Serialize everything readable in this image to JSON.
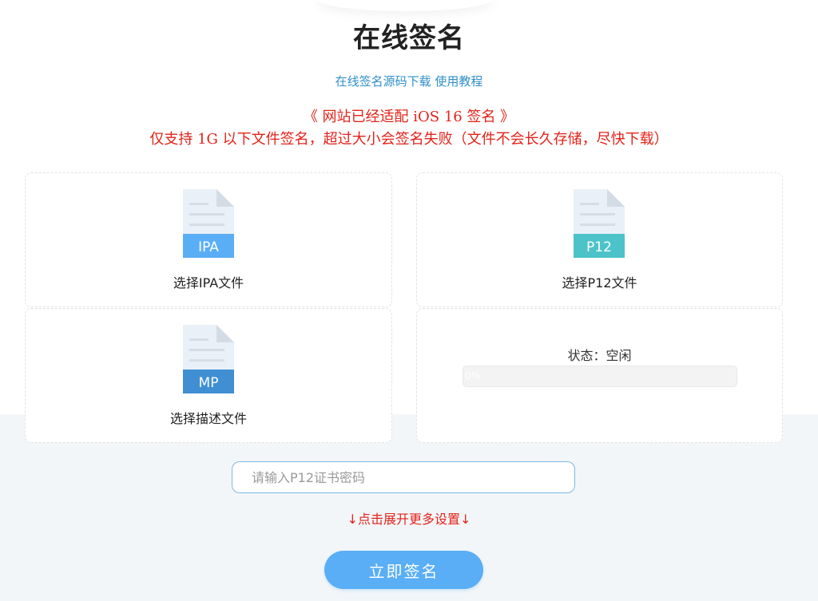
{
  "header": {
    "title": "在线签名",
    "links": [
      {
        "label": "在线签名源码下载"
      },
      {
        "label": "使用教程"
      }
    ]
  },
  "notices": {
    "line1": "《 网站已经适配 iOS 16 签名 》",
    "line2": "仅支持 1G 以下文件签名，超过大小会签名失败（文件不会长久存储，尽快下载）"
  },
  "uploads": {
    "ipa": {
      "icon_text": "IPA",
      "label": "选择IPA文件",
      "icon": "file-icon",
      "color": "#5aaef5"
    },
    "p12": {
      "icon_text": "P12",
      "label": "选择P12文件",
      "icon": "file-icon",
      "color": "#4cc3c8"
    },
    "mp": {
      "icon_text": "MP",
      "label": "选择描述文件",
      "icon": "file-icon",
      "color": "#3f8fd2"
    }
  },
  "status": {
    "label": "状态：空闲",
    "progress_text": "0%",
    "progress_value": 0
  },
  "form": {
    "password_placeholder": "请输入P12证书密码",
    "password_value": ""
  },
  "more_settings": "↓点击展开更多设置↓",
  "actions": {
    "sign_label": "立即签名"
  },
  "colors": {
    "title": "#222222",
    "link": "#2f8fc8",
    "notice": "#e2231a",
    "button": "#5aaef5",
    "file_body": "#e9f0f8"
  }
}
